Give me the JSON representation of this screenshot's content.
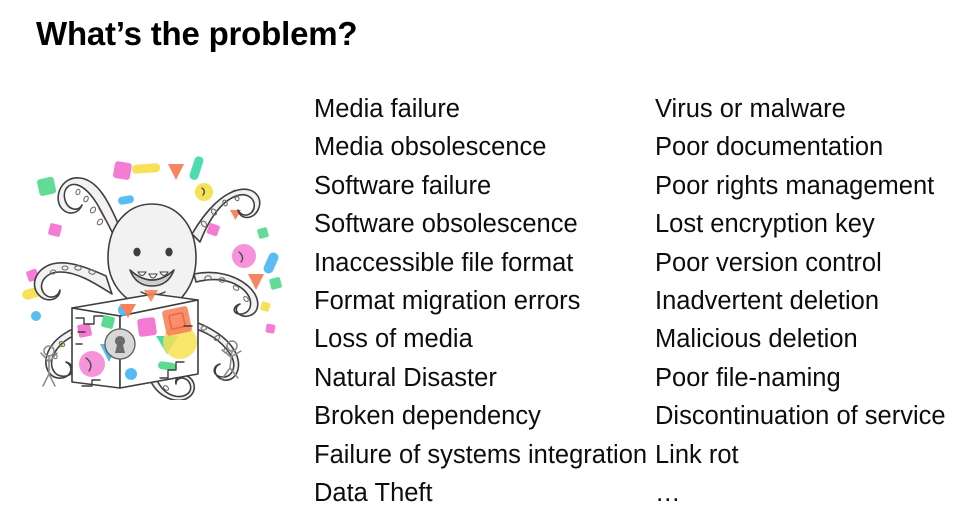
{
  "slide": {
    "title": "What’s the problem?",
    "background_color": "#ffffff",
    "text_color": "#0d0d0d"
  },
  "illustration": {
    "name": "octopus-guarding-safe-illustration",
    "description": "Line-art octopus with tentacles wrapped around a safe/vault covered in colorful confetti shapes, with two small stick figures",
    "palette": {
      "outline": "#3f3f3f",
      "body_fill": "#f2f2f2",
      "pink": "#f472d0",
      "magenta": "#ee5fc0",
      "orange": "#f97b52",
      "yellow": "#f7df4a",
      "green": "#55d98d",
      "teal": "#3fd9a8",
      "blue": "#4db8f0",
      "lightblue": "#7fd0f5"
    }
  },
  "lists": {
    "column_1": [
      "Media failure",
      "Media obsolescence",
      "Software failure",
      "Software obsolescence",
      "Inaccessible file format",
      "Format migration errors",
      "Loss of media",
      "Natural Disaster",
      "Broken dependency",
      "Failure of systems integration",
      "Data Theft"
    ],
    "column_2": [
      "Virus or malware",
      "Poor documentation",
      "Poor rights management",
      "Lost encryption key",
      "Poor version control",
      "Inadvertent deletion",
      "Malicious deletion",
      "Poor file-naming",
      "Discontinuation of service",
      "Link rot",
      "…"
    ]
  }
}
